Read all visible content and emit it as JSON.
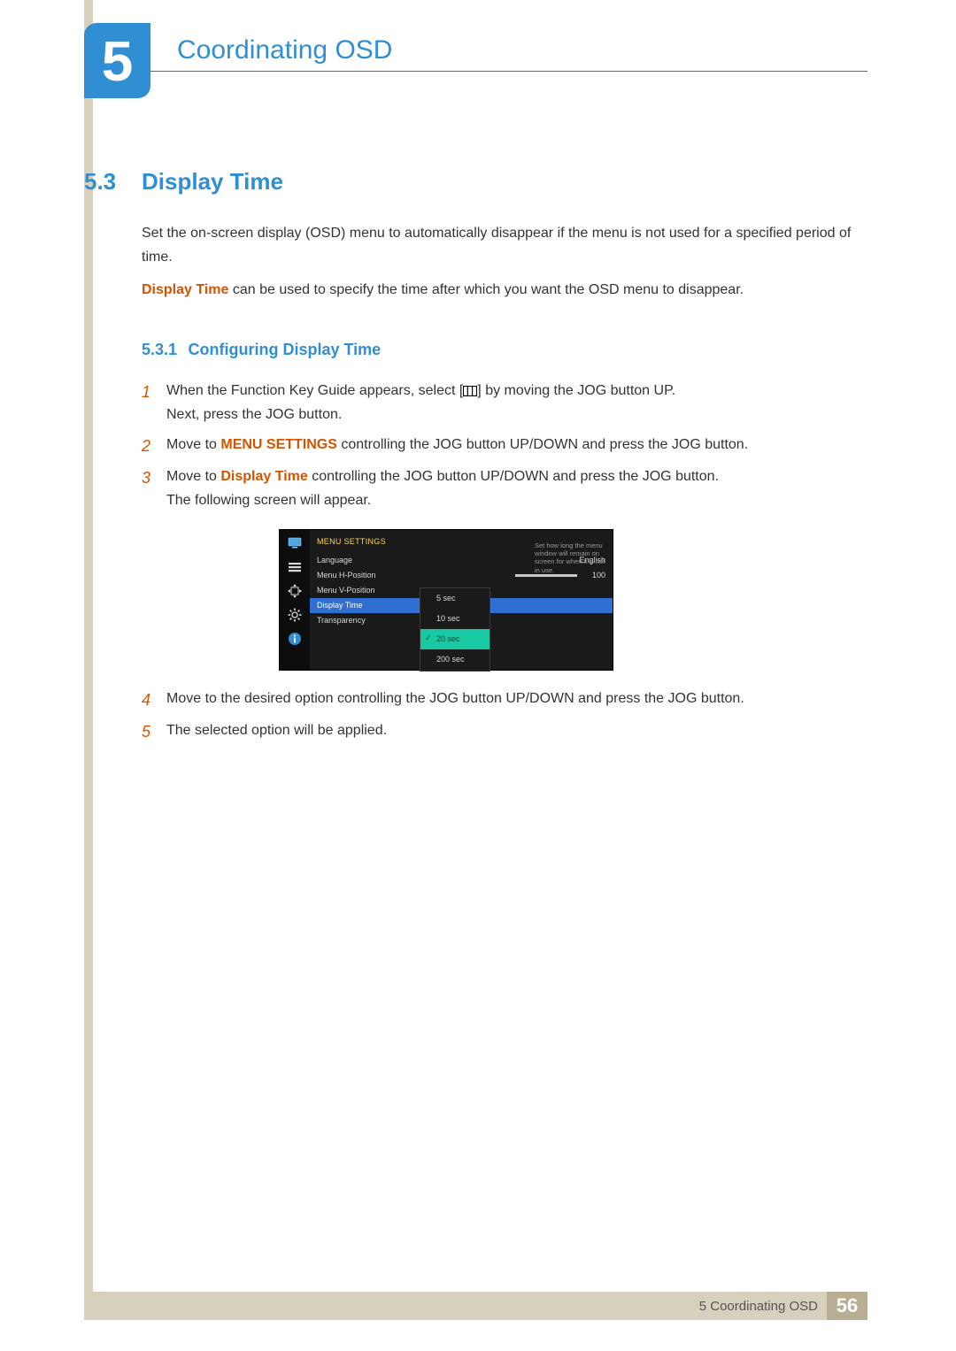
{
  "chapter": {
    "number": "5",
    "title": "Coordinating OSD"
  },
  "section": {
    "number": "5.3",
    "title": "Display Time"
  },
  "intro1": "Set the on-screen display (OSD) menu to automatically disappear if the menu is not used for a specified period of time.",
  "intro2a": "Display Time",
  "intro2b": " can be used to specify the time after which you want the OSD menu to disappear.",
  "subsection": {
    "number": "5.3.1",
    "title": "Configuring Display Time"
  },
  "steps": {
    "s1a": "When the Function Key Guide appears, select [",
    "s1b": "] by moving the JOG button UP.",
    "s1c": "Next, press the JOG button.",
    "s2a": "Move to ",
    "s2b": "MENU SETTINGS",
    "s2c": " controlling the JOG button UP/DOWN and press the JOG button.",
    "s3a": "Move to ",
    "s3b": "Display Time",
    "s3c": " controlling the JOG button UP/DOWN and press the JOG button.",
    "s3d": "The following screen will appear.",
    "s4": "Move to the desired option controlling the JOG button UP/DOWN and press the JOG button.",
    "s5": "The selected option will be applied."
  },
  "nums": {
    "n1": "1",
    "n2": "2",
    "n3": "3",
    "n4": "4",
    "n5": "5"
  },
  "osd": {
    "header": "MENU SETTINGS",
    "rows": {
      "language": {
        "label": "Language",
        "value": "English"
      },
      "hpos": {
        "label": "Menu H-Position",
        "value": "100"
      },
      "vpos": {
        "label": "Menu V-Position"
      },
      "display_time": {
        "label": "Display Time"
      },
      "transparency": {
        "label": "Transparency"
      }
    },
    "popup": {
      "o1": "5 sec",
      "o2": "10 sec",
      "o3": "20 sec",
      "o4": "200 sec"
    },
    "hint": "Set how long the menu window will remain on screen for when it is not in use."
  },
  "footer": {
    "text": "5 Coordinating OSD",
    "page": "56"
  }
}
